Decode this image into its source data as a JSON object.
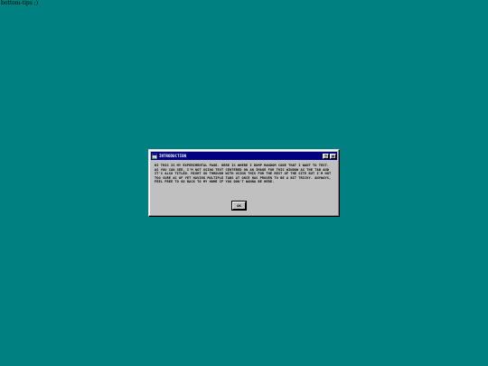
{
  "page": {
    "corner_text": "bottom-tips ;)",
    "background_color": "#008080"
  },
  "window": {
    "title": "INTRODUCTION",
    "icon": "app-window-icon",
    "title_bar_color": "#000080",
    "buttons": {
      "help": "question-mark-icon",
      "close": "close-icon"
    },
    "body": "HI THIS IS MY EXPERIMENTAL PAGE. HERE IS WHERE I DUMP RANDOM CODE THAT I WANT TO TEST.\nAS YOU CAN SEE, I'M NOT USING TEXT CENTERED ON AN IMAGE FOR THIS WINDOW AS THE TAB AND IT'S ALSO TITLED. MIGHT GO THROUGH WITH USING THIS FOR THE REST OF THE SITE BUT I'M NOT TOO SURE AS OF YET HAVING MULTIPLE TABS AT ONCE HAS PROVEN TO BE A BIT TRICKY. ANYWAYS, FEEL FREE TO GO BACK TO MY HOME IF YOU DON'T WANNA BE HERE.",
    "ok_label": "OK"
  }
}
